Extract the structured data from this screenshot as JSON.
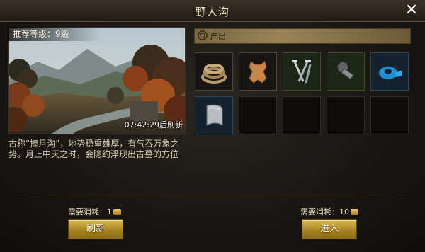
{
  "dialog": {
    "title": "野人沟",
    "close_label": "✕"
  },
  "scene": {
    "level_label": "推荐等级：9级",
    "refresh_timer": "07:42:29后刷新"
  },
  "description": "古称“捧月沟”，地势稳重雄厚，有气吞万象之势。月上中天之时，会隐约浮现出古墓的方位",
  "output": {
    "header": "产出",
    "items": [
      {
        "icon": "rope-icon"
      },
      {
        "icon": "leather-hide-icon"
      },
      {
        "icon": "nails-icon"
      },
      {
        "icon": "bolt-icon"
      },
      {
        "icon": "tape-roll-icon"
      },
      {
        "icon": "metal-plate-icon"
      }
    ],
    "empty_slots": 4
  },
  "left_action": {
    "cost_label": "需要消耗：",
    "cost_value": "1",
    "button_label": "刷新"
  },
  "right_action": {
    "cost_label": "需要消耗：",
    "cost_value": "10",
    "button_label": "进入"
  },
  "colors": {
    "gold_button": "#b8922c",
    "panel_bg": "#1a1714",
    "output_header": "#9a8558"
  }
}
